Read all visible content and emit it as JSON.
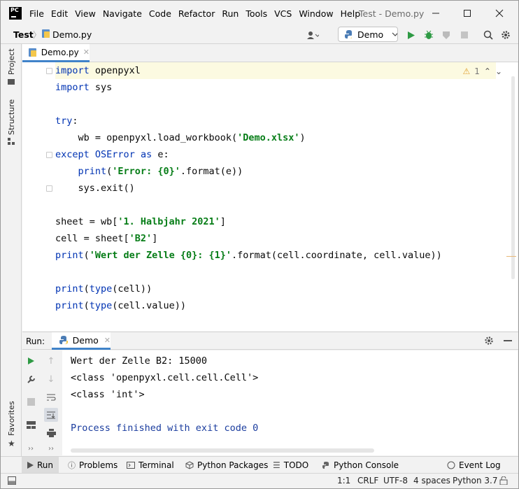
{
  "window": {
    "app_logo": "PC",
    "title": "Test - Demo.py",
    "menu": [
      "File",
      "Edit",
      "View",
      "Navigate",
      "Code",
      "Refactor",
      "Run",
      "Tools",
      "VCS",
      "Window",
      "Help"
    ]
  },
  "navbar": {
    "project": "Test",
    "file": "Demo.py",
    "run_config": "Demo"
  },
  "left_strip": {
    "project": "Project",
    "structure": "Structure",
    "favorites": "Favorites"
  },
  "editor": {
    "tab_label": "Demo.py",
    "inspection_count": "1",
    "lines": [
      [
        {
          "t": "import",
          "c": "kw"
        },
        {
          "t": " openpyxl",
          "c": "plain"
        }
      ],
      [
        {
          "t": "import",
          "c": "kw"
        },
        {
          "t": " sys",
          "c": "plain"
        }
      ],
      [],
      [
        {
          "t": "try",
          "c": "kw"
        },
        {
          "t": ":",
          "c": "plain"
        }
      ],
      [
        {
          "t": "    wb = openpyxl.load_workbook(",
          "c": "plain"
        },
        {
          "t": "'Demo.xlsx'",
          "c": "str"
        },
        {
          "t": ")",
          "c": "plain"
        }
      ],
      [
        {
          "t": "except",
          "c": "kw"
        },
        {
          "t": " ",
          "c": "plain"
        },
        {
          "t": "OSError",
          "c": "kw"
        },
        {
          "t": " ",
          "c": "plain"
        },
        {
          "t": "as",
          "c": "kw"
        },
        {
          "t": " e:",
          "c": "plain"
        }
      ],
      [
        {
          "t": "    ",
          "c": "plain"
        },
        {
          "t": "print",
          "c": "kw"
        },
        {
          "t": "(",
          "c": "plain"
        },
        {
          "t": "'Error: {0}'",
          "c": "str"
        },
        {
          "t": ".format(e))",
          "c": "plain"
        }
      ],
      [
        {
          "t": "    sys.exit()",
          "c": "plain"
        }
      ],
      [],
      [
        {
          "t": "sheet = wb[",
          "c": "plain"
        },
        {
          "t": "'1. Halbjahr 2021'",
          "c": "str"
        },
        {
          "t": "]",
          "c": "plain"
        }
      ],
      [
        {
          "t": "cell = sheet[",
          "c": "plain"
        },
        {
          "t": "'B2'",
          "c": "str"
        },
        {
          "t": "]",
          "c": "plain"
        }
      ],
      [
        {
          "t": "print",
          "c": "kw"
        },
        {
          "t": "(",
          "c": "plain"
        },
        {
          "t": "'Wert der Zelle {0}: {1}'",
          "c": "str"
        },
        {
          "t": ".format(cell.coordinate, cell.value))",
          "c": "plain"
        }
      ],
      [],
      [
        {
          "t": "print",
          "c": "kw"
        },
        {
          "t": "(",
          "c": "plain"
        },
        {
          "t": "type",
          "c": "kw"
        },
        {
          "t": "(cell))",
          "c": "plain"
        }
      ],
      [
        {
          "t": "print",
          "c": "kw"
        },
        {
          "t": "(",
          "c": "plain"
        },
        {
          "t": "type",
          "c": "kw"
        },
        {
          "t": "(cell.value))",
          "c": "plain"
        }
      ]
    ]
  },
  "run_panel": {
    "label": "Run:",
    "tab_label": "Demo",
    "output": [
      "Wert der Zelle B2: 15000",
      "<class 'openpyxl.cell.cell.Cell'>",
      "<class 'int'>",
      "",
      "Process finished with exit code 0"
    ]
  },
  "tool_tabs": [
    "Run",
    "Problems",
    "Terminal",
    "Python Packages",
    "TODO",
    "Python Console"
  ],
  "event_log": "Event Log",
  "status": {
    "position": "1:1",
    "line_sep": "CRLF",
    "encoding": "UTF-8",
    "indent": "4 spaces",
    "interpreter": "Python 3.7"
  },
  "colors": {
    "keyword": "#0033b3",
    "string": "#067d17",
    "accent": "#4083c9",
    "run_green": "#2e9a44",
    "exit_text": "#1a3c9e"
  }
}
